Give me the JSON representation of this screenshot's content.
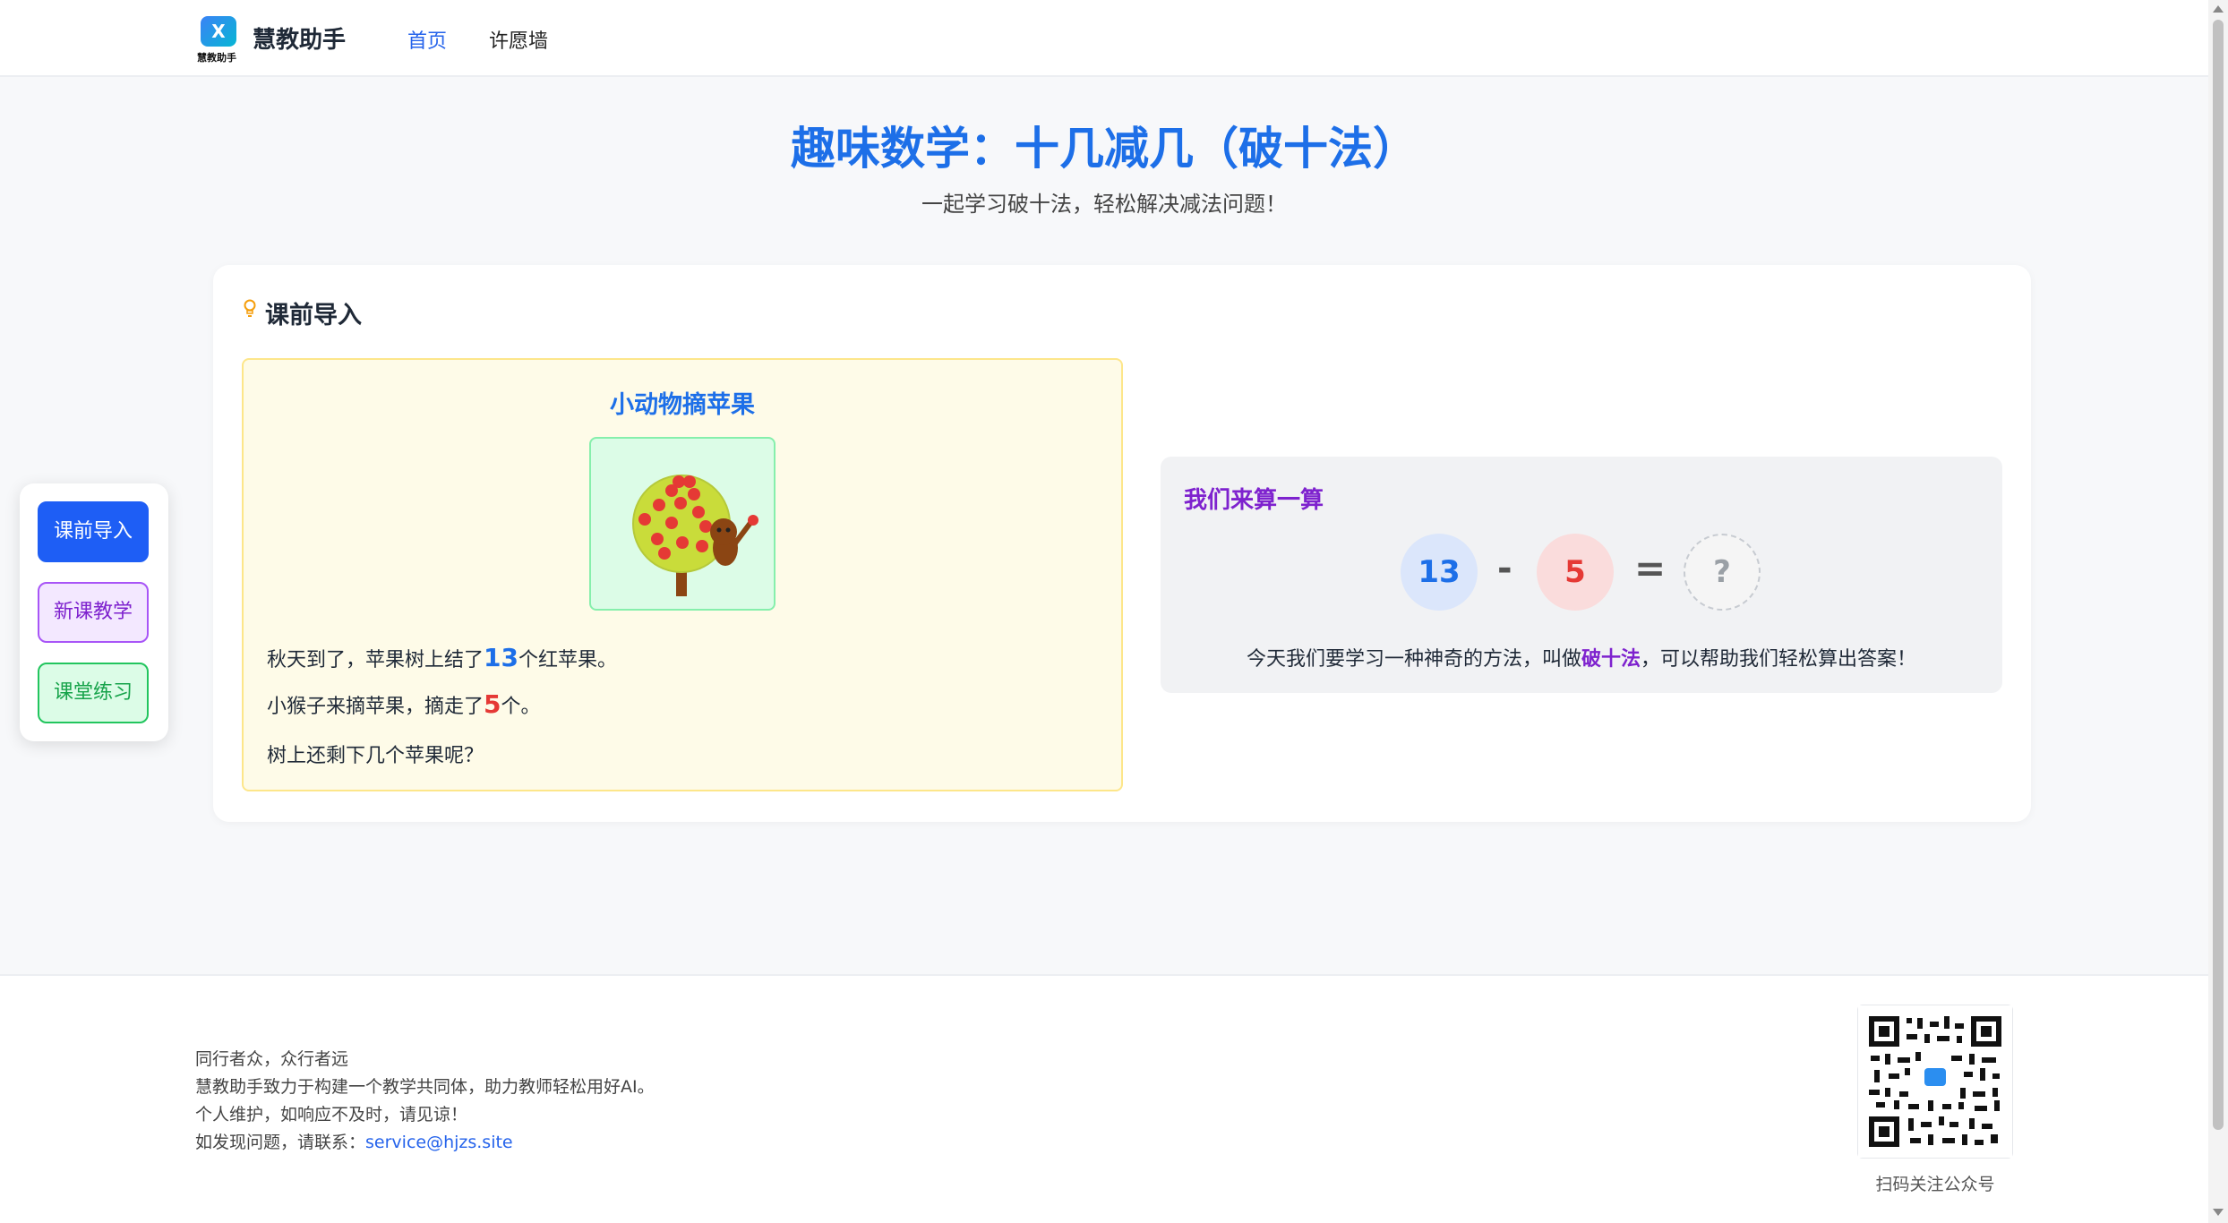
{
  "header": {
    "logo_mark": "X",
    "logo_caption": "慧教助手",
    "brand": "慧教助手",
    "nav": [
      {
        "label": "首页",
        "active": true
      },
      {
        "label": "许愿墙",
        "active": false
      }
    ]
  },
  "page": {
    "title": "趣味数学：十几减几（破十法）",
    "subtitle": "一起学习破十法，轻松解决减法问题！"
  },
  "side_nav": [
    {
      "label": "课前导入",
      "active": true
    },
    {
      "label": "新课教学",
      "active": false
    },
    {
      "label": "课堂练习",
      "active": false
    }
  ],
  "section": {
    "icon": "lightbulb-icon",
    "title": "课前导入"
  },
  "story": {
    "title": "小动物摘苹果",
    "line1_pre": "秋天到了，苹果树上结了",
    "line1_num": "13",
    "line1_post": "个红苹果。",
    "line2_pre": "小猴子来摘苹果，摘走了",
    "line2_num": "5",
    "line2_post": "个。",
    "line3": "树上还剩下几个苹果呢？"
  },
  "calc": {
    "title": "我们来算一算",
    "a": "13",
    "op": "-",
    "b": "5",
    "eq": "=",
    "result": "?",
    "text_pre": "今天我们要学习一种神奇的方法，叫做",
    "text_hl": "破十法",
    "text_post": "，可以帮助我们轻松算出答案！"
  },
  "footer": {
    "line1": "同行者众，众行者远",
    "line2": "慧教助手致力于构建一个教学共同体，助力教师轻松用好AI。",
    "line3": "个人维护，如响应不及时，请见谅！",
    "line4_pre": "如发现问题，请联系：",
    "email": "service@hjzs.site",
    "qr_caption": "扫码关注公众号"
  },
  "colors": {
    "primary": "#1d6fe8",
    "purple": "#7e22ce",
    "green": "#16a34a",
    "red": "#e53935"
  }
}
